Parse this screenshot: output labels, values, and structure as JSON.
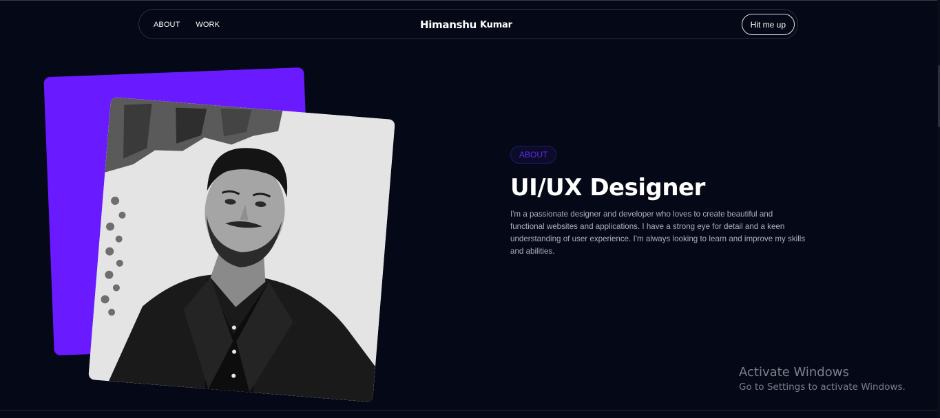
{
  "nav": {
    "links": [
      "ABOUT",
      "WORK"
    ],
    "brand_first": "Himanshu",
    "brand_last": "Kumar",
    "cta_label": "Hit me up"
  },
  "about": {
    "badge": "ABOUT",
    "headline": "UI/UX Designer",
    "bio": "I'm a passionate designer and developer who loves to create beautiful and functional websites and applications. I have a strong eye for detail and a keen understanding of user experience. I'm always looking to learn and improve my skills and abilities."
  },
  "windows_watermark": {
    "title": "Activate Windows",
    "subtitle": "Go to Settings to activate Windows."
  },
  "colors": {
    "background": "#050816",
    "accent_purple": "#6a1aff",
    "badge_text": "#5b2cf0",
    "body_text": "#aeb0bd"
  }
}
